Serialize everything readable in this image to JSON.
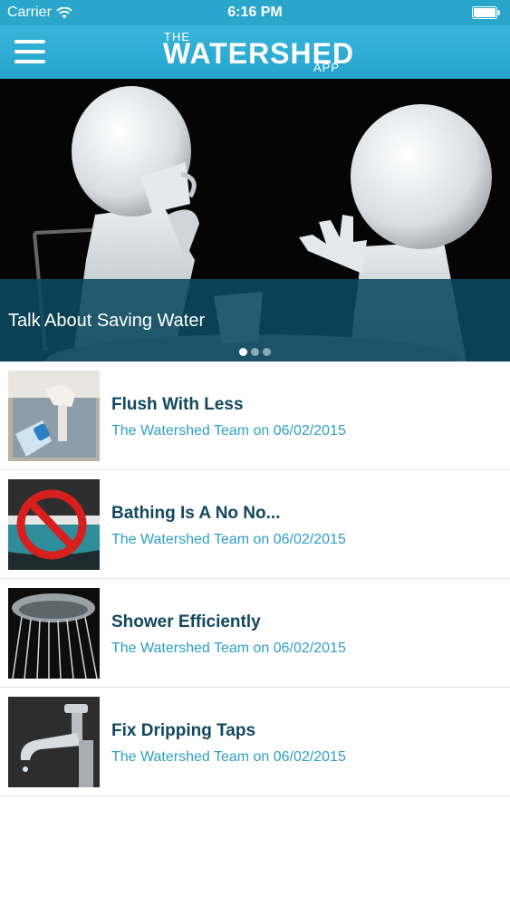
{
  "status": {
    "carrier": "Carrier",
    "time": "6:16 PM"
  },
  "header": {
    "logo_the": "THE",
    "logo_main": "WATERSHED",
    "logo_app": "APP"
  },
  "hero": {
    "caption": "Talk About Saving Water",
    "slide_count": 3,
    "active_slide": 1
  },
  "articles": [
    {
      "title": "Flush With Less",
      "meta": "The Watershed Team on 06/02/2015",
      "thumb": "toilet-cistern-bottle"
    },
    {
      "title": "Bathing Is A No No...",
      "meta": "The Watershed Team on 06/02/2015",
      "thumb": "bathtub-no-sign"
    },
    {
      "title": "Shower Efficiently",
      "meta": "The Watershed Team on 06/02/2015",
      "thumb": "shower-head-water"
    },
    {
      "title": "Fix Dripping Taps",
      "meta": "The Watershed Team on 06/02/2015",
      "thumb": "dripping-tap"
    }
  ],
  "colors": {
    "accent": "#2aa6cd",
    "title": "#10485f",
    "meta": "#2ca0c4",
    "overlay": "#0b4a60"
  }
}
